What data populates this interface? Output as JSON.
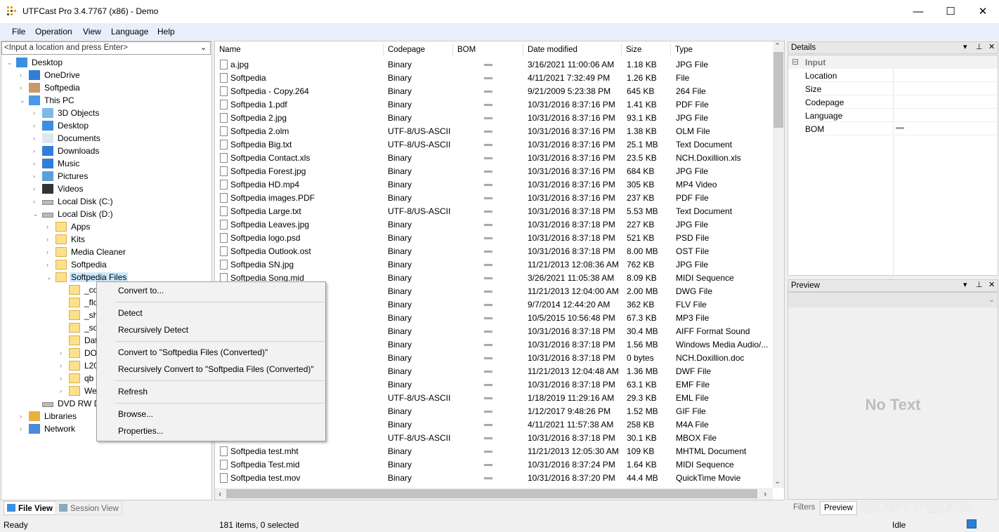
{
  "window": {
    "title": "UTFCast Pro 3.4.7767 (x86) - Demo",
    "minimize": "—",
    "maximize": "☐",
    "close": "✕"
  },
  "menu": [
    "File",
    "Operation",
    "View",
    "Language",
    "Help"
  ],
  "location": {
    "placeholder": "<Input a location and press Enter>",
    "arrow": "⌄"
  },
  "tree": {
    "expand": "›",
    "collapse": "⌄",
    "nodes": [
      {
        "label": "Desktop"
      },
      {
        "label": "OneDrive"
      },
      {
        "label": "Softpedia"
      },
      {
        "label": "This PC"
      },
      {
        "label": "3D Objects"
      },
      {
        "label": "Desktop"
      },
      {
        "label": "Documents"
      },
      {
        "label": "Downloads"
      },
      {
        "label": "Music"
      },
      {
        "label": "Pictures"
      },
      {
        "label": "Videos"
      },
      {
        "label": "Local Disk (C:)"
      },
      {
        "label": "Local Disk (D:)"
      },
      {
        "label": "Apps"
      },
      {
        "label": "Kits"
      },
      {
        "label": "Media Cleaner"
      },
      {
        "label": "Softpedia"
      },
      {
        "label": "Softpedia Files"
      },
      {
        "label": "_co"
      },
      {
        "label": "_flo"
      },
      {
        "label": "_sh"
      },
      {
        "label": "_so"
      },
      {
        "label": "Dat"
      },
      {
        "label": "DO"
      },
      {
        "label": "L20"
      },
      {
        "label": "qb"
      },
      {
        "label": "We"
      },
      {
        "label": "DVD RW D"
      },
      {
        "label": "Libraries"
      },
      {
        "label": "Network"
      }
    ]
  },
  "left_tabs": {
    "file_view": "File View",
    "session_view": "Session View"
  },
  "columns": [
    "Name",
    "Codepage",
    "BOM",
    "Date modified",
    "Size",
    "Type"
  ],
  "rows": [
    {
      "name": "a.jpg",
      "codepage": "Binary",
      "date": "3/16/2021 11:00:06 AM",
      "size": "1.18 KB",
      "type": "JPG File"
    },
    {
      "name": "Softpedia",
      "codepage": "Binary",
      "date": "4/11/2021 7:32:49 PM",
      "size": "1.26 KB",
      "type": "File"
    },
    {
      "name": "Softpedia - Copy.264",
      "codepage": "Binary",
      "date": "9/21/2009 5:23:38 PM",
      "size": "645 KB",
      "type": "264 File"
    },
    {
      "name": "Softpedia 1.pdf",
      "codepage": "Binary",
      "date": "10/31/2016 8:37:16 PM",
      "size": "1.41 KB",
      "type": "PDF File"
    },
    {
      "name": "Softpedia 2.jpg",
      "codepage": "Binary",
      "date": "10/31/2016 8:37:16 PM",
      "size": "93.1 KB",
      "type": "JPG File"
    },
    {
      "name": "Softpedia 2.olm",
      "codepage": "UTF-8/US-ASCII",
      "date": "10/31/2016 8:37:16 PM",
      "size": "1.38 KB",
      "type": "OLM File"
    },
    {
      "name": "Softpedia Big.txt",
      "codepage": "UTF-8/US-ASCII",
      "date": "10/31/2016 8:37:16 PM",
      "size": "25.1 MB",
      "type": "Text Document"
    },
    {
      "name": "Softpedia Contact.xls",
      "codepage": "Binary",
      "date": "10/31/2016 8:37:16 PM",
      "size": "23.5 KB",
      "type": "NCH.Doxillion.xls"
    },
    {
      "name": "Softpedia Forest.jpg",
      "codepage": "Binary",
      "date": "10/31/2016 8:37:16 PM",
      "size": "684 KB",
      "type": "JPG File"
    },
    {
      "name": "Softpedia HD.mp4",
      "codepage": "Binary",
      "date": "10/31/2016 8:37:16 PM",
      "size": "305 KB",
      "type": "MP4 Video"
    },
    {
      "name": "Softpedia images.PDF",
      "codepage": "Binary",
      "date": "10/31/2016 8:37:16 PM",
      "size": "237 KB",
      "type": "PDF File"
    },
    {
      "name": "Softpedia Large.txt",
      "codepage": "UTF-8/US-ASCII",
      "date": "10/31/2016 8:37:18 PM",
      "size": "5.53 MB",
      "type": "Text Document"
    },
    {
      "name": "Softpedia Leaves.jpg",
      "codepage": "Binary",
      "date": "10/31/2016 8:37:18 PM",
      "size": "227 KB",
      "type": "JPG File"
    },
    {
      "name": "Softpedia logo.psd",
      "codepage": "Binary",
      "date": "10/31/2016 8:37:18 PM",
      "size": "521 KB",
      "type": "PSD File"
    },
    {
      "name": "Softpedia Outlook.ost",
      "codepage": "Binary",
      "date": "10/31/2016 8:37:18 PM",
      "size": "8.00 MB",
      "type": "OST File"
    },
    {
      "name": "Softpedia SN.jpg",
      "codepage": "Binary",
      "date": "11/21/2013 12:08:36 AM",
      "size": "762 KB",
      "type": "JPG File"
    },
    {
      "name": "Softpedia Song.mid",
      "codepage": "Binary",
      "date": "3/26/2021 11:05:38 AM",
      "size": "8.09 KB",
      "type": "MIDI Sequence"
    },
    {
      "name": "wg",
      "codepage": "Binary",
      "date": "11/21/2013 12:04:00 AM",
      "size": "2.00 MB",
      "type": "DWG File"
    },
    {
      "name": "v",
      "codepage": "Binary",
      "date": "9/7/2014 12:44:20 AM",
      "size": "362 KB",
      "type": "FLV File"
    },
    {
      "name": "p3",
      "codepage": "Binary",
      "date": "10/5/2015 10:56:48 PM",
      "size": "67.3 KB",
      "type": "MP3 File"
    },
    {
      "name": "",
      "codepage": "Binary",
      "date": "10/31/2016 8:37:18 PM",
      "size": "30.4 MB",
      "type": "AIFF Format Sound"
    },
    {
      "name": "",
      "codepage": "Binary",
      "date": "10/31/2016 8:37:18 PM",
      "size": "1.56 MB",
      "type": "Windows Media Audio/..."
    },
    {
      "name": "",
      "codepage": "Binary",
      "date": "10/31/2016 8:37:18 PM",
      "size": "0 bytes",
      "type": "NCH.Doxillion.doc"
    },
    {
      "name": "",
      "codepage": "Binary",
      "date": "11/21/2013 12:04:48 AM",
      "size": "1.36 MB",
      "type": "DWF File"
    },
    {
      "name": "",
      "codepage": "Binary",
      "date": "10/31/2016 8:37:18 PM",
      "size": "63.1 KB",
      "type": "EMF File"
    },
    {
      "name": "",
      "codepage": "UTF-8/US-ASCII",
      "date": "1/18/2019 11:29:16 AM",
      "size": "29.3 KB",
      "type": "EML File"
    },
    {
      "name": "",
      "codepage": "Binary",
      "date": "1/12/2017 9:48:26 PM",
      "size": "1.52 MB",
      "type": "GIF File"
    },
    {
      "name": "",
      "codepage": "Binary",
      "date": "4/11/2021 11:57:38 AM",
      "size": "258 KB",
      "type": "M4A File"
    },
    {
      "name": "",
      "codepage": "UTF-8/US-ASCII",
      "date": "10/31/2016 8:37:18 PM",
      "size": "30.1 KB",
      "type": "MBOX File"
    },
    {
      "name": "Softpedia test.mht",
      "codepage": "Binary",
      "date": "11/21/2013 12:05:30 AM",
      "size": "109 KB",
      "type": "MHTML Document"
    },
    {
      "name": "Softpedia Test.mid",
      "codepage": "Binary",
      "date": "10/31/2016 8:37:24 PM",
      "size": "1.64 KB",
      "type": "MIDI Sequence"
    },
    {
      "name": "Softpedia test.mov",
      "codepage": "Binary",
      "date": "10/31/2016 8:37:20 PM",
      "size": "44.4 MB",
      "type": "QuickTime Movie"
    }
  ],
  "details": {
    "title": "Details",
    "group": "Input",
    "props": [
      "Location",
      "Size",
      "Codepage",
      "Language",
      "BOM"
    ],
    "buttons": {
      "dropdown": "▾",
      "pin": "⊥",
      "close": "✕"
    },
    "group_toggle": "⊟"
  },
  "preview": {
    "title": "Preview",
    "empty": "No Text"
  },
  "right_tabs": {
    "filters": "Filters",
    "preview": "Preview"
  },
  "context_menu": {
    "items": [
      "Convert to...",
      "Detect",
      "Recursively Detect",
      "Convert to \"Softpedia Files (Converted)\"",
      "Recursively Convert to \"Softpedia Files (Converted)\"",
      "Refresh",
      "Browse...",
      "Properties..."
    ]
  },
  "status": {
    "left": "Ready",
    "middle": "181 items, 0 selected",
    "right": "Idle"
  },
  "scroll": {
    "up": "⌃",
    "down": "⌄",
    "left": "‹",
    "right": "›"
  },
  "watermark": "SOFTPEDIA"
}
